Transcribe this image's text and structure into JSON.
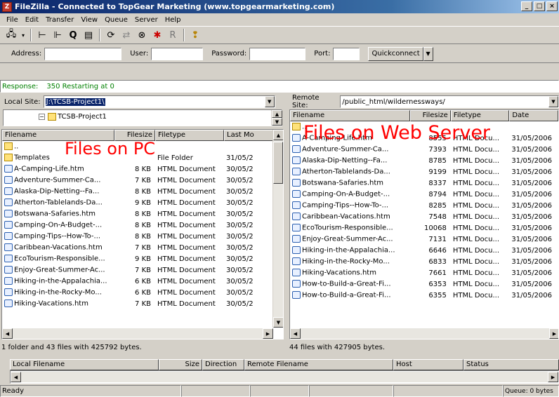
{
  "window": {
    "title": "FileZilla - Connected to TopGear Marketing (www.topgearmarketing.com)",
    "app_icon": "filezilla-icon",
    "buttons": [
      "_",
      "□",
      "×"
    ]
  },
  "menu": [
    "File",
    "Edit",
    "Transfer",
    "View",
    "Queue",
    "Server",
    "Help"
  ],
  "quickconnect": {
    "address_label": "Address:",
    "user_label": "User:",
    "password_label": "Password:",
    "port_label": "Port:",
    "button_label": "Quickconnect",
    "address_value": "",
    "user_value": "",
    "password_value": "",
    "port_value": ""
  },
  "log": {
    "label": "Response:",
    "message": "350 Restarting at 0"
  },
  "local": {
    "site_label": "Local Site:",
    "site_path": "J:\\TCSB-Project1\\",
    "tree_item": "TCSB-Project1",
    "overlay": "Files on PC",
    "columns": [
      "Filename",
      "Filesize",
      "Filetype",
      "Last Mo"
    ],
    "rows": [
      {
        "name": "..",
        "size": "",
        "type": "",
        "date": "",
        "icon": "up"
      },
      {
        "name": "Templates",
        "size": "",
        "type": "File Folder",
        "date": "31/05/2",
        "icon": "folder"
      },
      {
        "name": "A-Camping-Life.htm",
        "size": "8 KB",
        "type": "HTML Document",
        "date": "30/05/2",
        "icon": "html"
      },
      {
        "name": "Adventure-Summer-Ca...",
        "size": "7 KB",
        "type": "HTML Document",
        "date": "30/05/2",
        "icon": "html"
      },
      {
        "name": "Alaska-Dip-Netting--Fa...",
        "size": "8 KB",
        "type": "HTML Document",
        "date": "30/05/2",
        "icon": "html"
      },
      {
        "name": "Atherton-Tablelands-Da...",
        "size": "9 KB",
        "type": "HTML Document",
        "date": "30/05/2",
        "icon": "html"
      },
      {
        "name": "Botswana-Safaries.htm",
        "size": "8 KB",
        "type": "HTML Document",
        "date": "30/05/2",
        "icon": "html"
      },
      {
        "name": "Camping-On-A-Budget-...",
        "size": "8 KB",
        "type": "HTML Document",
        "date": "30/05/2",
        "icon": "html"
      },
      {
        "name": "Camping-Tips--How-To-...",
        "size": "8 KB",
        "type": "HTML Document",
        "date": "30/05/2",
        "icon": "html"
      },
      {
        "name": "Caribbean-Vacations.htm",
        "size": "7 KB",
        "type": "HTML Document",
        "date": "30/05/2",
        "icon": "html"
      },
      {
        "name": "EcoTourism-Responsible...",
        "size": "9 KB",
        "type": "HTML Document",
        "date": "30/05/2",
        "icon": "html"
      },
      {
        "name": "Enjoy-Great-Summer-Ac...",
        "size": "7 KB",
        "type": "HTML Document",
        "date": "30/05/2",
        "icon": "html"
      },
      {
        "name": "Hiking-in-the-Appalachia...",
        "size": "6 KB",
        "type": "HTML Document",
        "date": "30/05/2",
        "icon": "html"
      },
      {
        "name": "Hiking-in-the-Rocky-Mo...",
        "size": "6 KB",
        "type": "HTML Document",
        "date": "30/05/2",
        "icon": "html"
      },
      {
        "name": "Hiking-Vacations.htm",
        "size": "7 KB",
        "type": "HTML Document",
        "date": "30/05/2",
        "icon": "html"
      }
    ],
    "status": "1 folder and 43 files with 425792 bytes."
  },
  "remote": {
    "site_label": "Remote Site:",
    "site_path": "/public_html/wildernessways/",
    "overlay": "Files on Web Server",
    "columns": [
      "Filename",
      "Filesize",
      "Filetype",
      "Date"
    ],
    "rows": [
      {
        "name": "..",
        "size": "",
        "type": "",
        "date": "",
        "icon": "up"
      },
      {
        "name": "A-Camping-Life.htm",
        "size": "8555",
        "type": "HTML Docu...",
        "date": "31/05/2006",
        "icon": "html"
      },
      {
        "name": "Adventure-Summer-Ca...",
        "size": "7393",
        "type": "HTML Docu...",
        "date": "31/05/2006",
        "icon": "html"
      },
      {
        "name": "Alaska-Dip-Netting--Fa...",
        "size": "8785",
        "type": "HTML Docu...",
        "date": "31/05/2006",
        "icon": "html"
      },
      {
        "name": "Atherton-Tablelands-Da...",
        "size": "9199",
        "type": "HTML Docu...",
        "date": "31/05/2006",
        "icon": "html"
      },
      {
        "name": "Botswana-Safaries.htm",
        "size": "8337",
        "type": "HTML Docu...",
        "date": "31/05/2006",
        "icon": "html"
      },
      {
        "name": "Camping-On-A-Budget-...",
        "size": "8794",
        "type": "HTML Docu...",
        "date": "31/05/2006",
        "icon": "html"
      },
      {
        "name": "Camping-Tips--How-To-...",
        "size": "8285",
        "type": "HTML Docu...",
        "date": "31/05/2006",
        "icon": "html"
      },
      {
        "name": "Caribbean-Vacations.htm",
        "size": "7548",
        "type": "HTML Docu...",
        "date": "31/05/2006",
        "icon": "html"
      },
      {
        "name": "EcoTourism-Responsible...",
        "size": "10068",
        "type": "HTML Docu...",
        "date": "31/05/2006",
        "icon": "html"
      },
      {
        "name": "Enjoy-Great-Summer-Ac...",
        "size": "7131",
        "type": "HTML Docu...",
        "date": "31/05/2006",
        "icon": "html"
      },
      {
        "name": "Hiking-in-the-Appalachia...",
        "size": "6646",
        "type": "HTML Docu...",
        "date": "31/05/2006",
        "icon": "html"
      },
      {
        "name": "Hiking-in-the-Rocky-Mo...",
        "size": "6833",
        "type": "HTML Docu...",
        "date": "31/05/2006",
        "icon": "html"
      },
      {
        "name": "Hiking-Vacations.htm",
        "size": "7661",
        "type": "HTML Docu...",
        "date": "31/05/2006",
        "icon": "html"
      },
      {
        "name": "How-to-Build-a-Great-Fi...",
        "size": "6353",
        "type": "HTML Docu...",
        "date": "31/05/2006",
        "icon": "html"
      },
      {
        "name": "How-to-Build-a-Great-Fi...",
        "size": "6355",
        "type": "HTML Docu...",
        "date": "31/05/2006",
        "icon": "html"
      }
    ],
    "status": "44 files with 427905 bytes."
  },
  "queue": {
    "columns": [
      "Local Filename",
      "Size",
      "Direction",
      "Remote Filename",
      "Host",
      "Status"
    ]
  },
  "statusbar": {
    "ready": "Ready",
    "queue": "Queue: 0 bytes"
  }
}
